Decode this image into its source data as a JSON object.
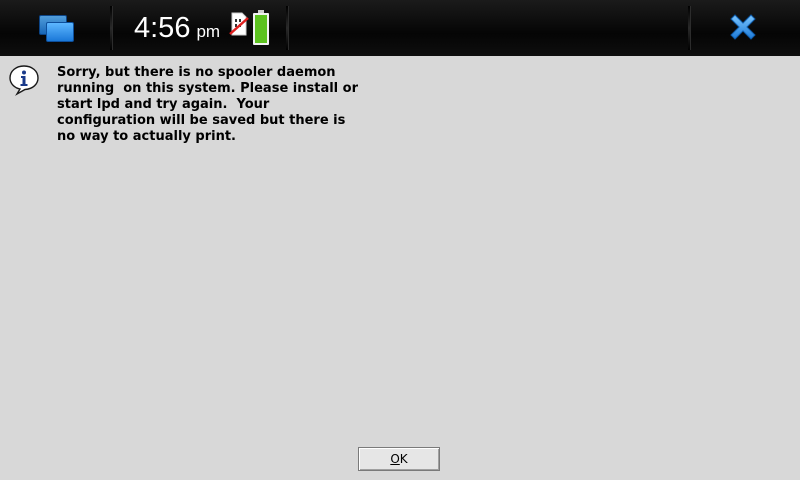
{
  "statusbar": {
    "time": "4:56",
    "ampm": "pm",
    "task_switcher_icon": "task-switcher-icon",
    "sim_icon": "no-sim-icon",
    "battery_icon": "battery-full-icon",
    "close_icon": "close-icon",
    "accent_color": "#1b78d8",
    "battery_color": "#5cc21f"
  },
  "dialog": {
    "icon": "info-icon",
    "message_lines": [
      "Sorry, but there is no spooler daemon",
      "running  on this system. Please install or",
      "start lpd and try again.  Your",
      "configuration will be saved but there is",
      "no way to actually print."
    ],
    "ok_button": {
      "mnemonic": "O",
      "rest": "K"
    }
  }
}
